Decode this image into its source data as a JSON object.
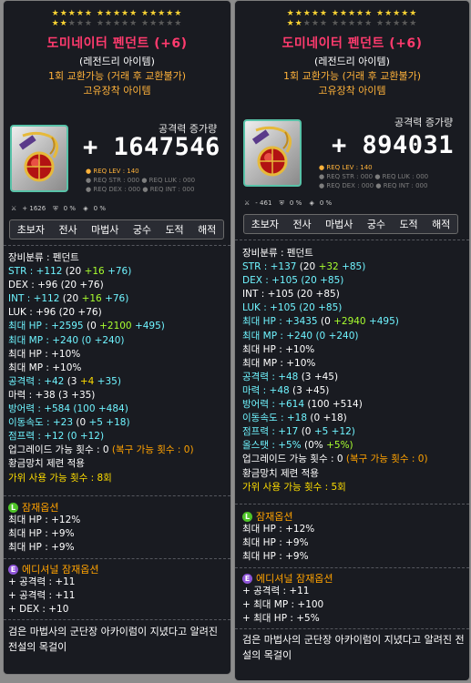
{
  "left": {
    "stars_row1": "★★★★★ ★★★★★ ★★★★★",
    "stars_row2_on": "★★",
    "stars_row2_off": "★★★ ★★★★★ ★★★★★",
    "title": "도미네이터 펜던트 (+6)",
    "grade": "(레전드리 아이템)",
    "trade": "1회 교환가능 (거래 후 교환불가)",
    "unique": "고유장착 아이템",
    "atk_label": "공격력 증가량",
    "atk_value": "+ 1647546",
    "req_lev": "● REQ LEV : 140",
    "req_line2": "● REQ STR : 000   ● REQ LUK : 000",
    "req_line3": "● REQ DEX : 000   ● REQ INT : 000",
    "mini_stats": [
      "+ 1626",
      "0 %",
      "0 %"
    ],
    "classes": [
      "초보자",
      "전사",
      "마법사",
      "궁수",
      "도적",
      "해적"
    ],
    "stats": [
      {
        "label": "장비분류 : 펜던트"
      },
      {
        "label": "STR : +112 ",
        "base": "(20 ",
        "plus1": "+16 ",
        "plus2": "+76)"
      },
      {
        "label": "DEX : +96 ",
        "base": "(20 +76)"
      },
      {
        "label": "INT : +112 ",
        "base": "(20 ",
        "plus1": "+16 ",
        "plus2": "+76)"
      },
      {
        "label": "LUK : +96 ",
        "base": "(20 +76)"
      },
      {
        "label": "최대 HP : +2595 ",
        "base": "(0 ",
        "plus1": "+2100 ",
        "plus2": "+495)"
      },
      {
        "label": "최대 MP : +240 ",
        "base": "(0 +240)"
      },
      {
        "label": "최대 HP : +10%"
      },
      {
        "label": "최대 MP : +10%"
      },
      {
        "label": "공격력 : +42 ",
        "base": "(3 ",
        "plus1": "+4 ",
        "plus2": "+35)"
      },
      {
        "label": "마력 : +38 ",
        "base": "(3 +35)"
      },
      {
        "label": "방어력 : +584 ",
        "base": "(100 +484)"
      },
      {
        "label": "이동속도 : +23 ",
        "base": "(0 ",
        "plus2": "+5 +18)"
      },
      {
        "label": "점프력 : +12 ",
        "base": "(0 +12)"
      }
    ],
    "upgrade": "업그레이드 가능 횟수 : 0 ",
    "upgrade_restore": "(복구 가능 횟수 : 0)",
    "golden_hammer": "황금망치 제련 적용",
    "scissors": "가위 사용 가능 횟수 : 8회",
    "potential_header": "잠재옵션",
    "potential": [
      "최대 HP : +12%",
      "최대 HP : +9%",
      "최대 HP : +9%"
    ],
    "additional_header": "에디셔널 잠재옵션",
    "additional": [
      "+ 공격력 : +11",
      "+ 공격력 : +11",
      "+ DEX : +10"
    ],
    "description": "검은 마법사의 군단장 아카이럼이 지녔다고 알려진 전설의 목걸이"
  },
  "right": {
    "stars_row1": "★★★★★ ★★★★★ ★★★★★",
    "stars_row2_on": "★★",
    "stars_row2_off": "★★★ ★★★★★ ★★★★★",
    "title": "도미네이터 펜던트 (+6)",
    "grade": "(레전드리 아이템)",
    "trade": "1회 교환가능 (거래 후 교환불가)",
    "unique": "고유장착 아이템",
    "atk_label": "공격력 증가량",
    "atk_value": "+ 894031",
    "req_lev": "● REQ LEV : 140",
    "req_line2": "● REQ STR : 000   ● REQ LUK : 000",
    "req_line3": "● REQ DEX : 000   ● REQ INT : 000",
    "mini_stats": [
      "- 461",
      "0 %",
      "0 %"
    ],
    "classes": [
      "초보자",
      "전사",
      "마법사",
      "궁수",
      "도적",
      "해적"
    ],
    "stats": [
      {
        "label": "장비분류 : 펜던트"
      },
      {
        "label": "STR : +137 ",
        "base": "(20 ",
        "plus1": "+32 ",
        "plus2": "+85)"
      },
      {
        "label": "DEX : +105 ",
        "base": "(20 +85)"
      },
      {
        "label": "INT : +105 ",
        "base": "(20 +85)"
      },
      {
        "label": "LUK : +105 ",
        "base": "(20 +85)"
      },
      {
        "label": "최대 HP : +3435 ",
        "base": "(0 ",
        "plus1": "+2940 ",
        "plus2": "+495)"
      },
      {
        "label": "최대 MP : +240 ",
        "base": "(0 +240)"
      },
      {
        "label": "최대 HP : +10%"
      },
      {
        "label": "최대 MP : +10%"
      },
      {
        "label": "공격력 : +48 ",
        "base": "(3 +45)"
      },
      {
        "label": "마력 : +48 ",
        "base": "(3 +45)"
      },
      {
        "label": "방어력 : +614 ",
        "base": "(100 +514)"
      },
      {
        "label": "이동속도 : +18 ",
        "base": "(0 +18)"
      },
      {
        "label": "점프력 : +17 ",
        "base": "(0 ",
        "plus2": "+5 +12)"
      },
      {
        "label": "올스탯 : +5% ",
        "base": "(0% ",
        "plus2": "+5%)"
      }
    ],
    "upgrade": "업그레이드 가능 횟수 : 0 ",
    "upgrade_restore": "(복구 가능 횟수 : 0)",
    "golden_hammer": "황금망치 제련 적용",
    "scissors": "가위 사용 가능 횟수 : 5회",
    "potential_header": "잠재옵션",
    "potential": [
      "최대 HP : +12%",
      "최대 HP : +9%",
      "최대 HP : +9%"
    ],
    "additional_header": "에디셔널 잠재옵션",
    "additional": [
      "+ 공격력 : +11",
      "+ 최대 MP : +100",
      "+ 최대 HP : +5%"
    ],
    "description": "검은 마법사의 군단장 아카이럼이 지녔다고 알려진 전설의 목걸이"
  },
  "badges": {
    "legendary": "L",
    "epic": "E"
  },
  "colors": {
    "title": "#ff3b6e",
    "stat_cyan": "#6ff4ff",
    "stat_green": "#a9ff2f",
    "stat_yellow": "#ffde00",
    "orange": "#ffa200",
    "legendary_badge": "#4fc428",
    "epic_badge": "#8f56d8"
  },
  "icons": {
    "item": "dominator-pendant-icon"
  }
}
